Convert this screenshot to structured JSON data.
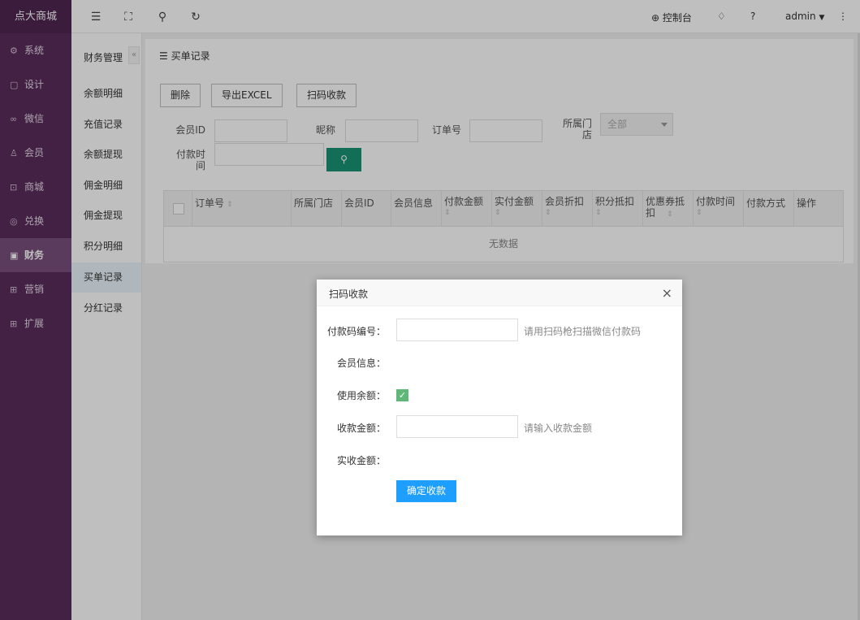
{
  "sidebar": {
    "logo": "点大商城",
    "items": [
      {
        "icon": "⚙",
        "label": "系统"
      },
      {
        "icon": "▢",
        "label": "设计"
      },
      {
        "icon": "∞",
        "label": "微信"
      },
      {
        "icon": "♙",
        "label": "会员"
      },
      {
        "icon": "⊡",
        "label": "商城"
      },
      {
        "icon": "◎",
        "label": "兑换"
      },
      {
        "icon": "▣",
        "label": "财务"
      },
      {
        "icon": "⊞",
        "label": "营销"
      },
      {
        "icon": "⊞",
        "label": "扩展"
      }
    ]
  },
  "topbar": {
    "console_label": "控制台",
    "user_label": "admin"
  },
  "submenu": {
    "title": "财务管理",
    "collapse": "«",
    "items": [
      "余额明细",
      "充值记录",
      "余额提现",
      "佣金明细",
      "佣金提现",
      "积分明细",
      "买单记录",
      "分红记录"
    ]
  },
  "panel": {
    "title": "买单记录",
    "buttons": {
      "delete": "删除",
      "export": "导出EXCEL",
      "scan": "扫码收款"
    },
    "filters": {
      "member_id": "会员ID",
      "nickname": "昵称",
      "order_no": "订单号",
      "store": "所属门店",
      "store_value": "全部",
      "pay_time": "付款时间"
    },
    "table": {
      "headers": [
        "订单号",
        "所属门店",
        "会员ID",
        "会员信息",
        "付款金额",
        "实付金额",
        "会员折扣",
        "积分抵扣",
        "优惠券抵扣",
        "付款时间",
        "付款方式",
        "操作"
      ],
      "empty": "无数据"
    }
  },
  "modal": {
    "title": "扫码收款",
    "close": "×",
    "fields": {
      "pay_code_label": "付款码编号：",
      "pay_code_hint": "请用扫码枪扫描微信付款码",
      "member_info_label": "会员信息：",
      "use_balance_label": "使用余额：",
      "amount_label": "收款金额：",
      "amount_hint": "请输入收款金额",
      "actual_label": "实收金额："
    },
    "submit": "确定收款"
  }
}
